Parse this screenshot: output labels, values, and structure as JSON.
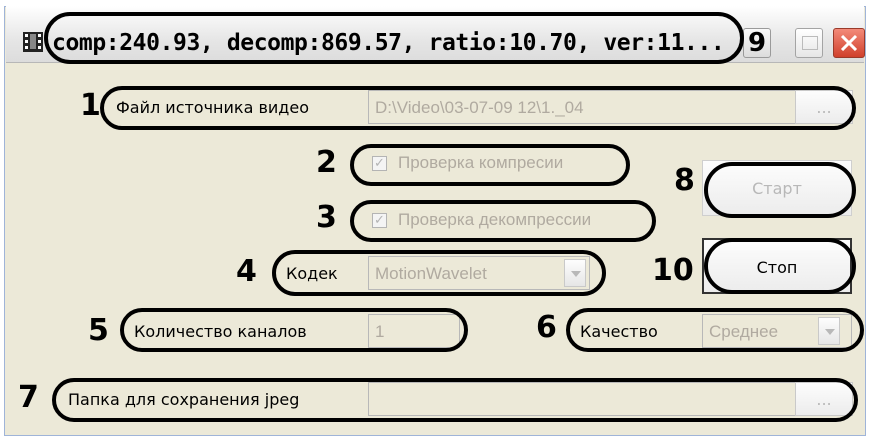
{
  "window": {
    "title": "comp:240.93, decomp:869.57, ratio:10.70, ver:11...",
    "help_button": "9",
    "icon": "film-icon"
  },
  "fields": {
    "video_source": {
      "label": "Файл источника видео",
      "value": "D:\\Video\\03-07-09 12\\1._04",
      "browse": "..."
    },
    "codec": {
      "label": "Кодек",
      "value": "MotionWavelet"
    },
    "channels": {
      "label": "Количество каналов",
      "value": "1"
    },
    "quality": {
      "label": "Качество",
      "value": "Среднее"
    },
    "jpeg_folder": {
      "label": "Папка для сохранения jpeg",
      "value": "",
      "browse": "..."
    }
  },
  "checks": {
    "compression": {
      "label": "Проверка компресии",
      "checked": true
    },
    "decompression": {
      "label": "Проверка декомпрессии",
      "checked": true
    }
  },
  "buttons": {
    "start": "Старт",
    "stop": "Стоп"
  },
  "callouts": {
    "n1": "1",
    "n2": "2",
    "n3": "3",
    "n4": "4",
    "n5": "5",
    "n6": "6",
    "n7": "7",
    "n8": "8",
    "n10": "10"
  }
}
